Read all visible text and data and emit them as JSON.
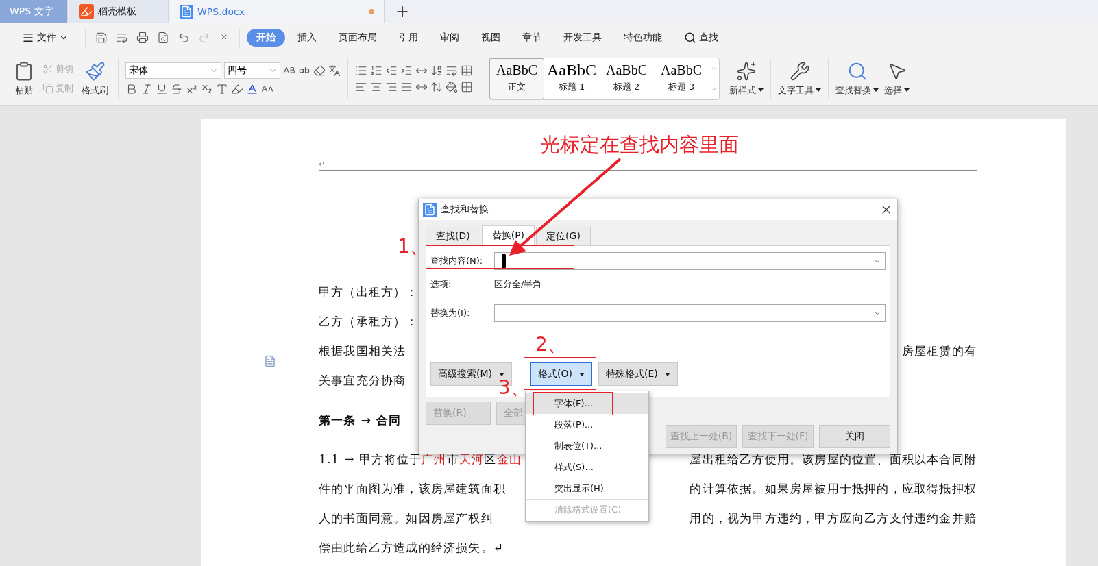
{
  "title_tabs": [
    {
      "label": "WPS 文字",
      "kind": "app",
      "selected": false
    },
    {
      "label": "稻壳模板",
      "kind": "template",
      "selected": false
    },
    {
      "label": "WPS.docx",
      "kind": "document",
      "selected": true,
      "modified": true
    }
  ],
  "new_tab": "+",
  "menu": {
    "file": "文件",
    "tabs": [
      {
        "label": "开始",
        "selected": true
      },
      {
        "label": "插入",
        "selected": false
      },
      {
        "label": "页面布局",
        "selected": false
      },
      {
        "label": "引用",
        "selected": false
      },
      {
        "label": "审阅",
        "selected": false
      },
      {
        "label": "视图",
        "selected": false
      },
      {
        "label": "章节",
        "selected": false
      },
      {
        "label": "开发工具",
        "selected": false
      },
      {
        "label": "特色功能",
        "selected": false
      }
    ],
    "search": "查找"
  },
  "ribbon": {
    "clipboard": {
      "paste": "粘贴",
      "cut": {
        "label": "剪切",
        "disabled": true
      },
      "copy": {
        "label": "复制",
        "disabled": true
      },
      "painter": "格式刷"
    },
    "font": {
      "name": "宋体",
      "size": "四号"
    },
    "styles": [
      {
        "sample": "AaBbC",
        "label": "正文",
        "kind": "body",
        "selected": true
      },
      {
        "sample": "AaBbC",
        "label": "标题 1",
        "kind": "h1",
        "selected": false
      },
      {
        "sample": "AaBbC",
        "label": "标题 2",
        "kind": "h2",
        "selected": false
      },
      {
        "sample": "AaBbC",
        "label": "标题 3",
        "kind": "h3",
        "selected": false
      }
    ],
    "tools": [
      {
        "label": "新样式",
        "kind": "new-style"
      },
      {
        "label": "文字工具",
        "kind": "text-tools"
      },
      {
        "label": "查找替换",
        "kind": "find-replace"
      },
      {
        "label": "选择",
        "kind": "select"
      }
    ]
  },
  "document": {
    "header_mark": "↵",
    "lines": [
      {
        "kind": "body",
        "left": [
          {
            "text": "甲方（出租方）："
          }
        ]
      },
      {
        "kind": "body",
        "left": [
          {
            "text": "乙方（承租方）："
          }
        ]
      },
      {
        "kind": "body",
        "left": [
          {
            "text": "根据我国相关法"
          }
        ],
        "right": "房屋租赁的有"
      },
      {
        "kind": "body",
        "left": [
          {
            "text": "关事宜充分协商"
          }
        ]
      },
      {
        "kind": "heading",
        "left": [
          {
            "text": "第一条 → 合同"
          }
        ]
      },
      {
        "kind": "body",
        "left": [
          {
            "text": "1.1 → 甲方将位于",
            "red": false
          },
          {
            "text": "广州",
            "red": true
          },
          {
            "text": "市",
            "red": false
          },
          {
            "text": "天河",
            "red": true
          },
          {
            "text": "区",
            "red": false
          },
          {
            "text": "金山",
            "red": true
          }
        ],
        "right": "屋出租给乙方使用。该房屋的位置、面积以本合同附"
      },
      {
        "kind": "body",
        "left": [
          {
            "text": "件的平面图为准，该房屋建筑面积"
          }
        ],
        "right": "的计算依据。如果房屋被用于抵押的，应取得抵押权"
      },
      {
        "kind": "body",
        "left": [
          {
            "text": "人的书面同意。如因房屋产权纠"
          }
        ],
        "right": "用的，视为甲方违约，甲方应向乙方支付违约金并赔"
      },
      {
        "kind": "body",
        "left": [
          {
            "text": "偿由此给乙方造成的经济损失。↵"
          }
        ]
      }
    ]
  },
  "dialog": {
    "title": "查找和替换",
    "tabs": [
      {
        "label": "查找(D)",
        "selected": false
      },
      {
        "label": "替换(P)",
        "selected": true
      },
      {
        "label": "定位(G)",
        "selected": false
      }
    ],
    "find": {
      "label": "查找内容(N):",
      "focused": true
    },
    "options": {
      "label": "选项:",
      "value": "区分全/半角"
    },
    "replace": {
      "label": "替换为(I):",
      "focused": false
    },
    "buttons": [
      {
        "label": "高级搜索(M)",
        "selected": false
      },
      {
        "label": "格式(O)",
        "selected": true
      },
      {
        "label": "特殊格式(E)",
        "selected": false
      }
    ],
    "actions": [
      {
        "label": "替换(R)",
        "disabled": true
      },
      {
        "label": "全部",
        "disabled": true
      }
    ],
    "nav": [
      {
        "label": "查找上一处(B)",
        "disabled": true
      },
      {
        "label": "查找下一处(F)",
        "disabled": true
      },
      {
        "label": "关闭",
        "disabled": false
      }
    ]
  },
  "format_menu": [
    {
      "label": "字体(F)...",
      "selected": true,
      "disabled": false
    },
    {
      "label": "段落(P)...",
      "selected": false,
      "disabled": false
    },
    {
      "label": "制表位(T)...",
      "selected": false,
      "disabled": false
    },
    {
      "label": "样式(S)...",
      "selected": false,
      "disabled": false
    },
    {
      "label": "突出显示(H)",
      "selected": false,
      "disabled": false
    },
    {
      "label": "清除格式设置(C)",
      "selected": false,
      "disabled": true
    }
  ],
  "annotations": {
    "callout": "光标定在查找内容里面",
    "steps": [
      "1、",
      "2、",
      "3、"
    ]
  }
}
